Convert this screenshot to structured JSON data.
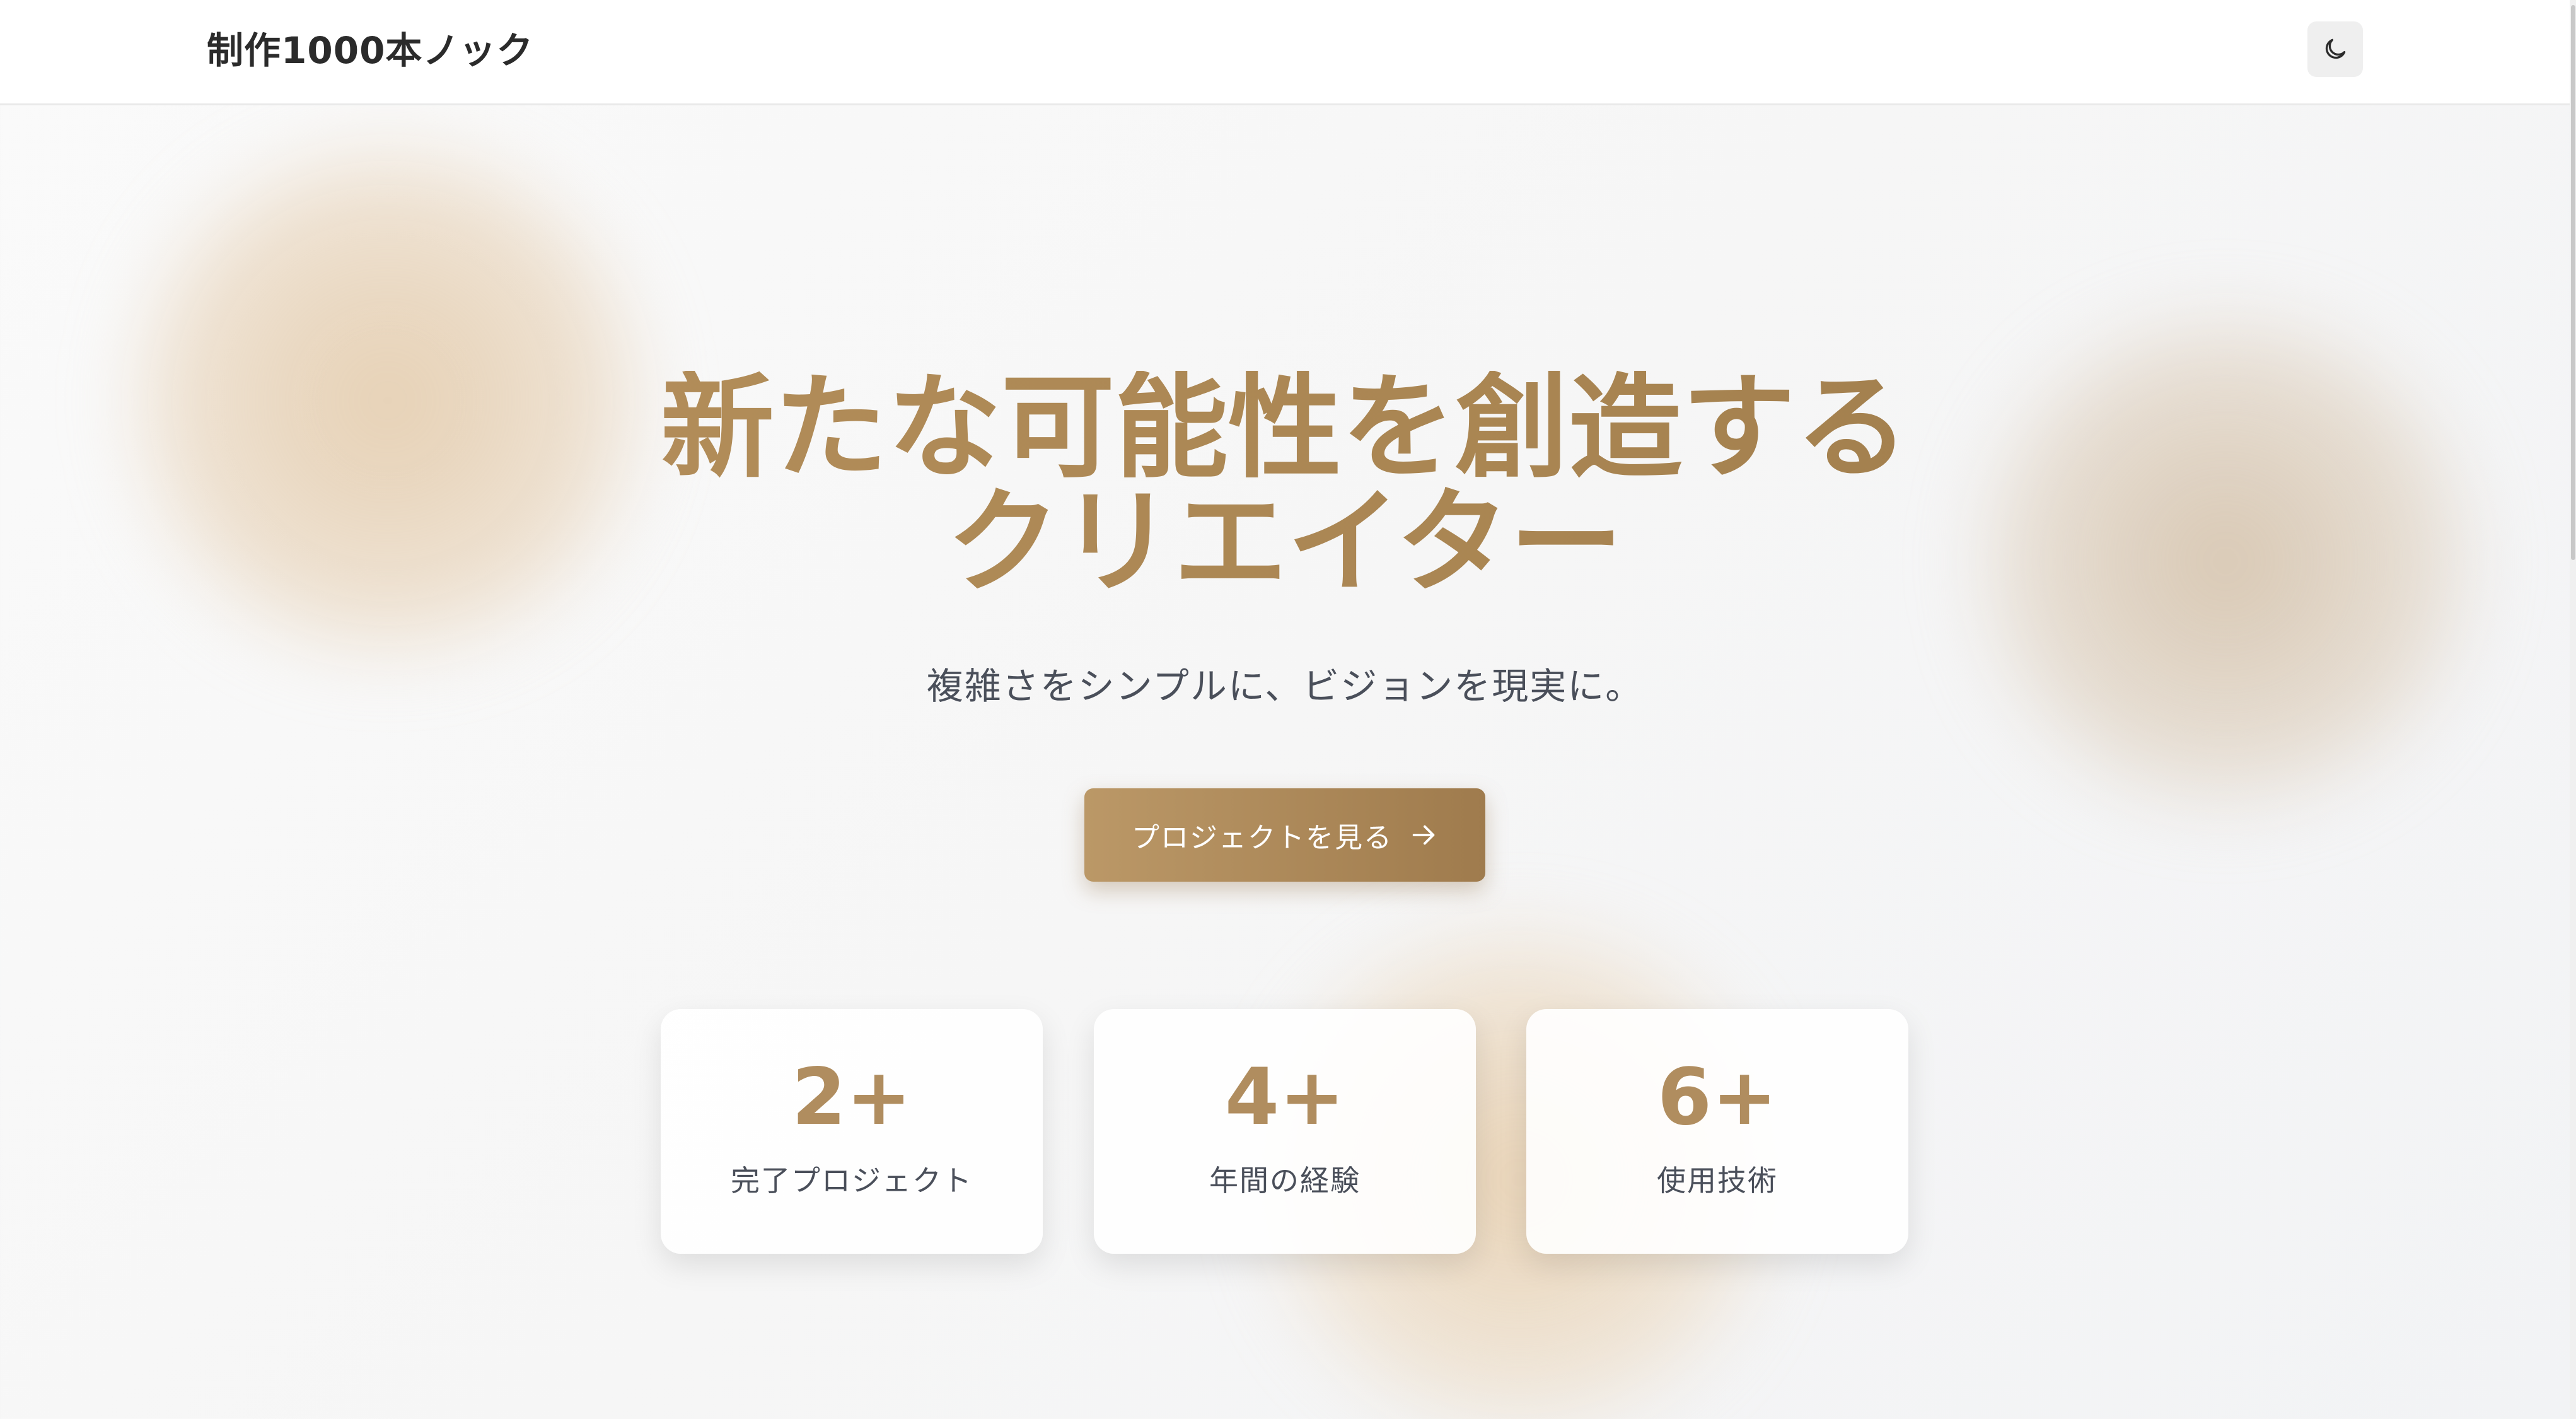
{
  "header": {
    "brand": "制作1000本ノック",
    "theme_toggle_icon": "moon-icon"
  },
  "hero": {
    "title_line1": "新たな可能性を創造する",
    "title_line2": "クリエイター",
    "subtitle": "複雑さをシンプルに、ビジョンを現実に。",
    "cta_label": "プロジェクトを見る",
    "cta_icon": "arrow-right-icon"
  },
  "stats": [
    {
      "value": "2+",
      "label": "完了プロジェクト"
    },
    {
      "value": "4+",
      "label": "年間の経験"
    },
    {
      "value": "6+",
      "label": "使用技術"
    }
  ],
  "colors": {
    "accent": "#b08d5f",
    "accent_dark": "#9f7b4d",
    "text": "#2b2b2b",
    "muted_text": "#4a4f5a"
  }
}
